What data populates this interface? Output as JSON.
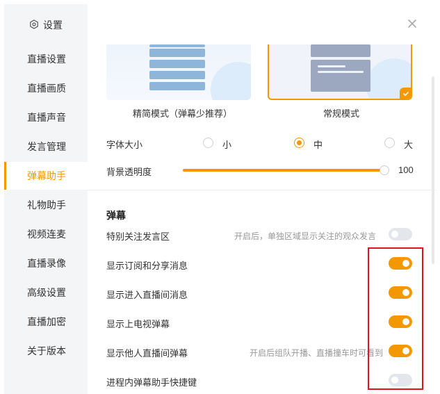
{
  "sidebar": {
    "title": "设置",
    "items": [
      {
        "label": "直播设置"
      },
      {
        "label": "直播画质"
      },
      {
        "label": "直播声音"
      },
      {
        "label": "发言管理"
      },
      {
        "label": "弹幕助手",
        "active": true
      },
      {
        "label": "礼物助手"
      },
      {
        "label": "视频连麦"
      },
      {
        "label": "直播录像"
      },
      {
        "label": "高级设置"
      },
      {
        "label": "直播加密"
      },
      {
        "label": "关于版本"
      }
    ]
  },
  "modes": {
    "simple_label": "精简模式（弹幕少推荐）",
    "normal_label": "常规模式",
    "selected": "常规模式"
  },
  "font_size": {
    "label": "字体大小",
    "options": [
      "小",
      "中",
      "大"
    ],
    "selected": "中"
  },
  "opacity": {
    "label": "背景透明度",
    "value": "100",
    "level": 1.0
  },
  "danmaku": {
    "section_title": "弹幕",
    "rows": [
      {
        "label": "特别关注发言区",
        "desc": "开启后，单独区域显示关注的观众发言",
        "on": false
      },
      {
        "label": "显示订阅和分享消息",
        "desc": "",
        "on": true
      },
      {
        "label": "显示进入直播间消息",
        "desc": "",
        "on": true
      },
      {
        "label": "显示上电视弹幕",
        "desc": "",
        "on": true
      },
      {
        "label": "显示他人直播间弹幕",
        "desc": "开启后组队开播、直播撞车时可看到",
        "on": true
      },
      {
        "label": "进程内弹幕助手快捷键",
        "desc": "",
        "on": false
      }
    ]
  },
  "colors": {
    "accent": "#f39800",
    "highlight": "#e0141e"
  }
}
